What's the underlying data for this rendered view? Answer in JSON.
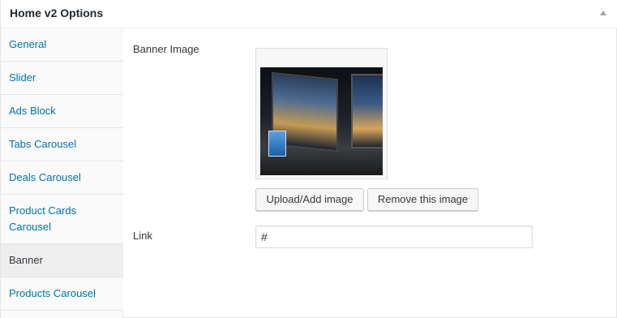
{
  "panel": {
    "title": "Home v2 Options"
  },
  "sidebar": {
    "items": [
      {
        "label": "General"
      },
      {
        "label": "Slider"
      },
      {
        "label": "Ads Block"
      },
      {
        "label": "Tabs Carousel"
      },
      {
        "label": "Deals Carousel"
      },
      {
        "label": "Product Cards Carousel"
      },
      {
        "label": "Banner",
        "active": true
      },
      {
        "label": "Products Carousel"
      }
    ]
  },
  "banner": {
    "image_label": "Banner Image",
    "upload_button": "Upload/Add image",
    "remove_button": "Remove this image",
    "link_label": "Link",
    "link_value": "#"
  }
}
